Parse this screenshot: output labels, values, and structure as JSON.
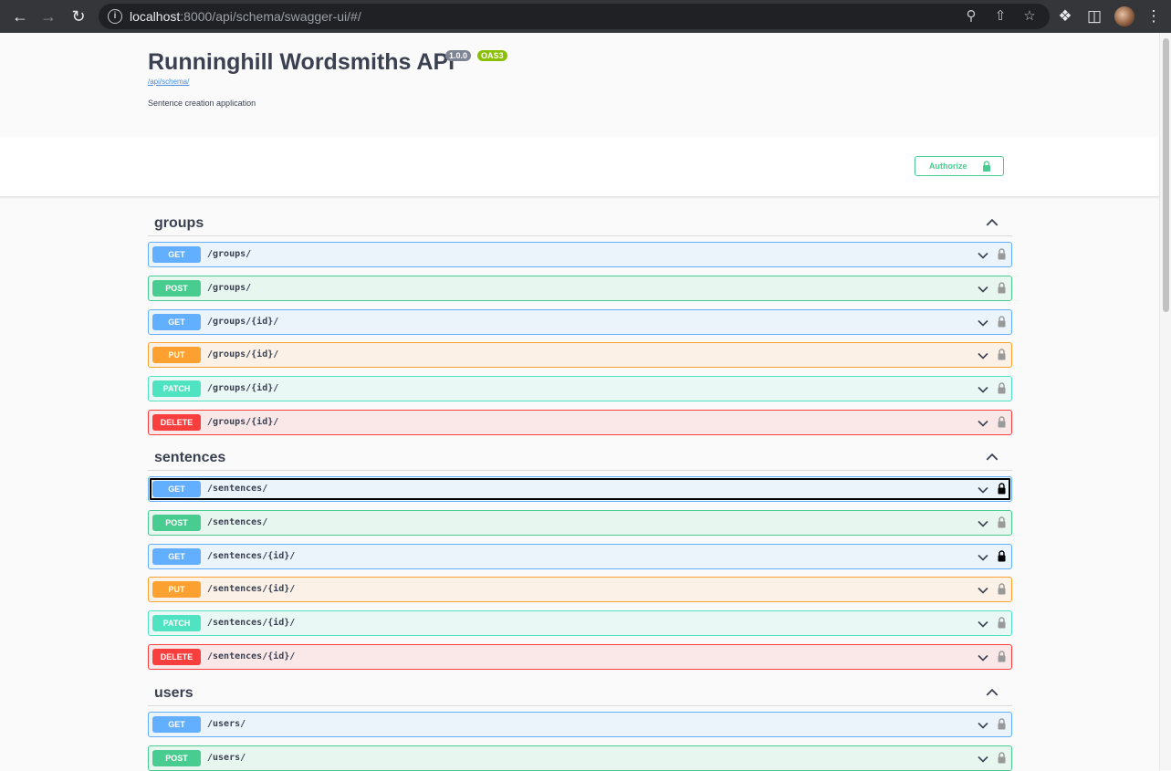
{
  "browser": {
    "url_host": "localhost",
    "url_rest": ":8000/api/schema/swagger-ui/#/"
  },
  "api": {
    "title": "Runninghill Wordsmiths API",
    "version": "1.0.0",
    "spec": "OAS3",
    "schema_link": "/api/schema/",
    "description": "Sentence creation application"
  },
  "authorize": {
    "label": "Authorize"
  },
  "tags": [
    {
      "name": "groups",
      "operations": [
        {
          "method": "GET",
          "path": "/groups/"
        },
        {
          "method": "POST",
          "path": "/groups/"
        },
        {
          "method": "GET",
          "path": "/groups/{id}/"
        },
        {
          "method": "PUT",
          "path": "/groups/{id}/"
        },
        {
          "method": "PATCH",
          "path": "/groups/{id}/"
        },
        {
          "method": "DELETE",
          "path": "/groups/{id}/"
        }
      ]
    },
    {
      "name": "sentences",
      "operations": [
        {
          "method": "GET",
          "path": "/sentences/"
        },
        {
          "method": "POST",
          "path": "/sentences/"
        },
        {
          "method": "GET",
          "path": "/sentences/{id}/"
        },
        {
          "method": "PUT",
          "path": "/sentences/{id}/"
        },
        {
          "method": "PATCH",
          "path": "/sentences/{id}/"
        },
        {
          "method": "DELETE",
          "path": "/sentences/{id}/"
        }
      ]
    },
    {
      "name": "users",
      "operations": [
        {
          "method": "GET",
          "path": "/users/"
        },
        {
          "method": "POST",
          "path": "/users/"
        }
      ]
    }
  ],
  "colors": {
    "get": "#61affe",
    "post": "#49cc90",
    "put": "#fca130",
    "patch": "#50e3c2",
    "delete": "#f93e3e"
  }
}
